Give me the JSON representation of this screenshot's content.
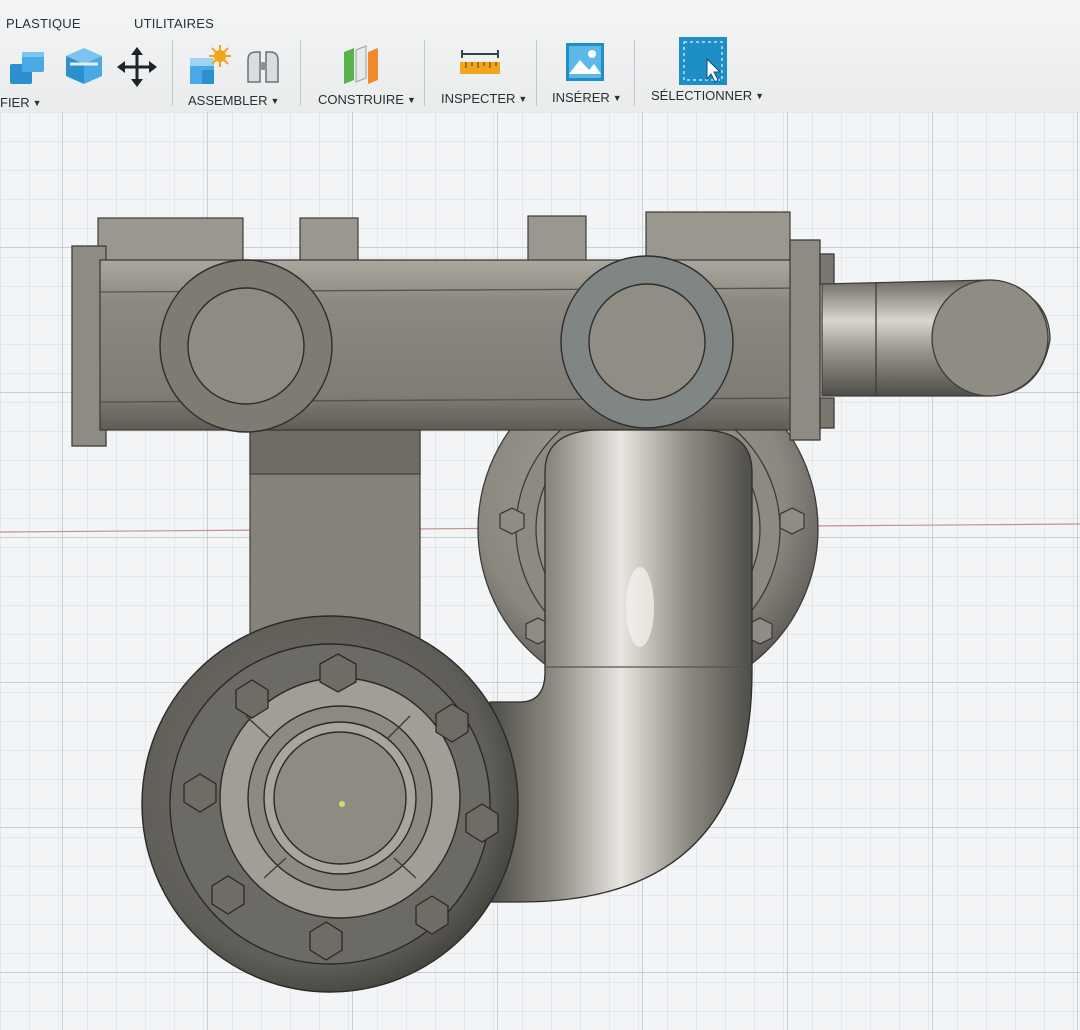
{
  "toolbar": {
    "tabs": {
      "plastique": "PLASTIQUE",
      "utilitaires": "UTILITAIRES"
    },
    "groups": {
      "modifier": "FIER",
      "assembler": "ASSEMBLER",
      "construire": "CONSTRUIRE",
      "inspecter": "INSPECTER",
      "inserer": "INSÉRER",
      "selectionner": "SÉLECTIONNER"
    },
    "icons": {
      "modify_1": "push-pull-icon",
      "modify_2": "shell-icon",
      "modify_3": "move-icon",
      "assemble_1": "new-component-icon",
      "assemble_2": "joint-icon",
      "construct": "offset-plane-icon",
      "inspect": "measure-icon",
      "insert": "insert-image-icon",
      "select": "select-icon"
    }
  },
  "colors": {
    "toolbar_bg": "#eceef0",
    "canvas_bg": "#f2f4f6",
    "grid_minor": "#d5dce2",
    "grid_major": "#bcc5cd",
    "model_metal": "#8f8c84",
    "accent_blue": "#1e8fc6"
  }
}
